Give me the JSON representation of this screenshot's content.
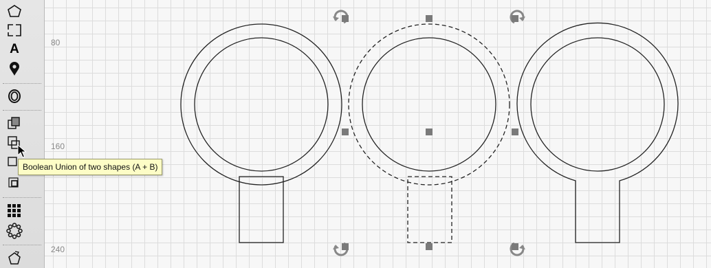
{
  "tooltip": {
    "text": "Boolean Union of two shapes (A + B)"
  },
  "ruler": {
    "labels": [
      "80",
      "160",
      "240"
    ]
  },
  "toolbar": {
    "tools": [
      {
        "name": "polygon-tool-icon"
      },
      {
        "name": "rectangle-tool-icon"
      },
      {
        "name": "text-tool-icon",
        "glyph": "A"
      },
      {
        "name": "location-pin-icon"
      },
      {
        "name": "circle-offset-icon"
      },
      {
        "name": "boolean-union-icon"
      },
      {
        "name": "boolean-difference-icon"
      },
      {
        "name": "boolean-intersection-icon"
      },
      {
        "name": "boolean-exclusion-icon"
      },
      {
        "name": "grid-array-icon"
      },
      {
        "name": "circular-array-icon"
      },
      {
        "name": "transform-tool-icon"
      }
    ]
  },
  "colors": {
    "selection_handle": "#7a7a7a",
    "stroke": "#222222",
    "tooltip_bg": "#fdfdc6"
  }
}
